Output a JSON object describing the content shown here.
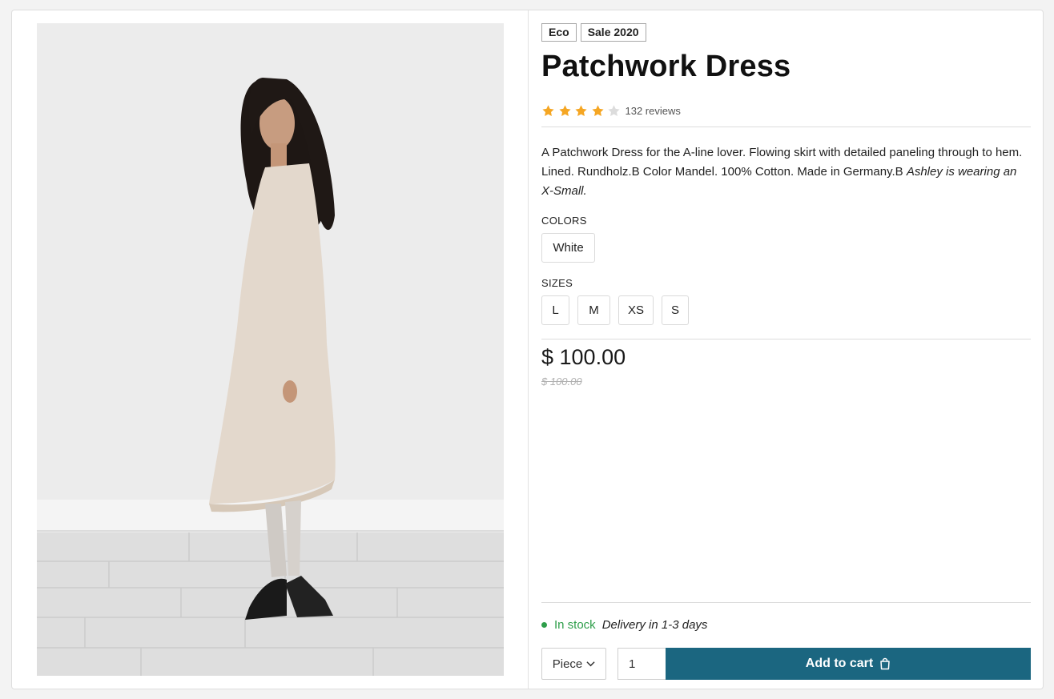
{
  "product": {
    "badges": [
      "Eco",
      "Sale 2020"
    ],
    "title": "Patchwork Dress",
    "rating": 4,
    "rating_max": 5,
    "reviews_label": "132 reviews",
    "description": "A Patchwork Dress for the A-line lover. Flowing skirt with detailed paneling through to hem. Lined. Rundholz.B Color Mandel. 100% Cotton. Made in Germany.B",
    "description_italic": "Ashley is wearing an X-Small.",
    "image_alt": "Model wearing patchwork dress"
  },
  "colors": {
    "label": "COLORS",
    "options": [
      "White"
    ]
  },
  "sizes": {
    "label": "SIZES",
    "options": [
      "L",
      "M",
      "XS",
      "S"
    ]
  },
  "pricing": {
    "price": "$ 100.00",
    "old_price": "$ 100.00"
  },
  "stock": {
    "status": "In stock",
    "delivery": "Delivery in 1-3 days",
    "status_color": "#2e9e4a"
  },
  "cart": {
    "unit": "Piece",
    "quantity": "1",
    "add_label": "Add to cart",
    "button_color": "#1b6680"
  },
  "colors_palette": {
    "star_filled": "#f5a623",
    "star_empty": "#dcdcdc"
  }
}
